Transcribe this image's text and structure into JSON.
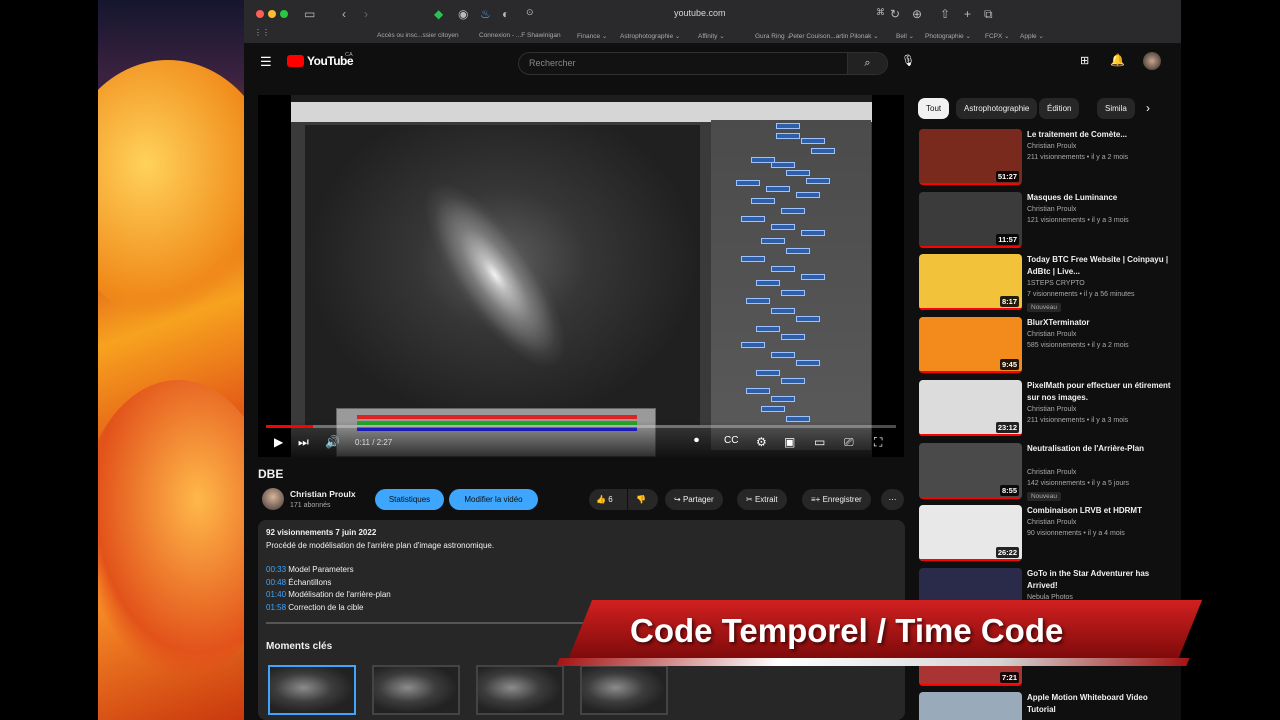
{
  "browser": {
    "url": "youtube.com",
    "bookmarks": [
      "Accès ou insc...ssier citoyen",
      "Connexion - ...F Shawinigan",
      "Finance ⌄",
      "Astrophotographie ⌄",
      "Affinity ⌄",
      "Gura Ring ⌄",
      "Peter Coulson...artin Pilonak ⌄",
      "Bell ⌄",
      "Photographie ⌄",
      "FCPX ⌄",
      "Apple ⌄"
    ]
  },
  "youtube": {
    "logo": "YouTube",
    "region": "CA",
    "search_placeholder": "Rechercher"
  },
  "player": {
    "time": "0:11 / 2:27",
    "progress": 0.075
  },
  "video": {
    "title": "DBE",
    "channel": "Christian Proulx",
    "subscribers": "171 abonnés",
    "stats_label": "Statistiques",
    "edit_label": "Modifier la vidéo",
    "likes": "6",
    "share_label": "Partager",
    "clip_label": "Extrait",
    "save_label": "Enregistrer"
  },
  "description": {
    "meta": "92 visionnements  7 juin 2022",
    "text": "Procédé de modélisation de l'arrière plan d'image astronomique.",
    "chapters": [
      {
        "time": "00:33",
        "label": "Model Parameters"
      },
      {
        "time": "00:48",
        "label": "Échantillons"
      },
      {
        "time": "01:40",
        "label": "Modélisation de l'arrière-plan"
      },
      {
        "time": "01:58",
        "label": "Correction de la cible"
      }
    ],
    "moments_title": "Moments clés"
  },
  "chips": [
    "Tout",
    "Astrophotographie",
    "Édition",
    "Simila"
  ],
  "recommendations": [
    {
      "title": "Le traitement de Comète...",
      "channel": "Christian Proulx",
      "meta": "211 visionnements  • il y a 2 mois",
      "duration": "51:27",
      "thumb_color": "#7a2a1c"
    },
    {
      "title": "Masques de Luminance",
      "channel": "Christian Proulx",
      "meta": "121 visionnements  • il y a 3 mois",
      "duration": "11:57",
      "thumb_color": "#3b3b3b"
    },
    {
      "title": "Today BTC Free Website | Coinpayu | AdBtc | Live...",
      "channel": "1STEPS CRYPTO",
      "meta": "7 visionnements  • il y a 56 minutes",
      "duration": "8:17",
      "badge": "Nouveau",
      "thumb_color": "#f2c23b"
    },
    {
      "title": "BlurXTerminator",
      "channel": "Christian Proulx",
      "meta": "585 visionnements  • il y a 2 mois",
      "duration": "9:45",
      "thumb_color": "#f28b1b"
    },
    {
      "title": "PixelMath pour effectuer un étirement sur nos images.",
      "channel": "Christian Proulx",
      "meta": "211 visionnements  • il y a 3 mois",
      "duration": "23:12",
      "thumb_color": "#dcdcdc"
    },
    {
      "title": "Neutralisation de l'Arrière-Plan",
      "channel": "Christian Proulx",
      "meta": "142 visionnements  • il y a 5 jours",
      "duration": "8:55",
      "badge": "Nouveau",
      "thumb_color": "#4a4a4a"
    },
    {
      "title": "Combinaison LRVB et HDRMT",
      "channel": "Christian Proulx",
      "meta": "90 visionnements  • il y a 4 mois",
      "duration": "26:22",
      "thumb_color": "#e8e8e8"
    },
    {
      "title": "GoTo in the Star Adventurer has Arrived!",
      "channel": "Nebula Photos",
      "meta": "",
      "duration": "",
      "thumb_color": "#2a2a4a"
    },
    {
      "title": "",
      "channel": "",
      "meta": "",
      "duration": "7:21",
      "thumb_color": "#a33"
    },
    {
      "title": "Apple Motion Whiteboard Video Tutorial",
      "channel": "",
      "meta": "",
      "duration": "",
      "thumb_color": "#9ab"
    }
  ],
  "banner": {
    "text": "Code Temporel / Time Code"
  }
}
